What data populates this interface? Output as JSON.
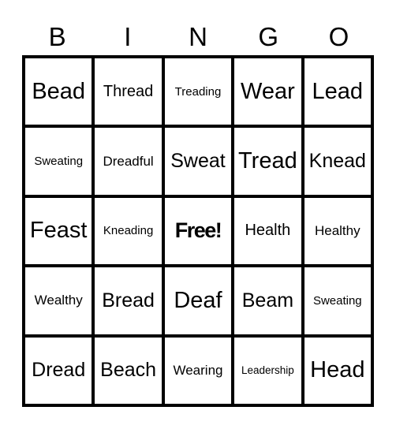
{
  "header": {
    "letters": [
      "B",
      "I",
      "N",
      "G",
      "O"
    ]
  },
  "card": {
    "rows": [
      [
        "Bead",
        "Thread",
        "Treading",
        "Wear",
        "Lead"
      ],
      [
        "Sweating",
        "Dreadful",
        "Sweat",
        "Tread",
        "Knead"
      ],
      [
        "Feast",
        "Kneading",
        "Free!",
        "Health",
        "Healthy"
      ],
      [
        "Wealthy",
        "Bread",
        "Deaf",
        "Beam",
        "Sweating"
      ],
      [
        "Dread",
        "Beach",
        "Wearing",
        "Leadership",
        "Head"
      ]
    ],
    "free_space": "Free!"
  }
}
